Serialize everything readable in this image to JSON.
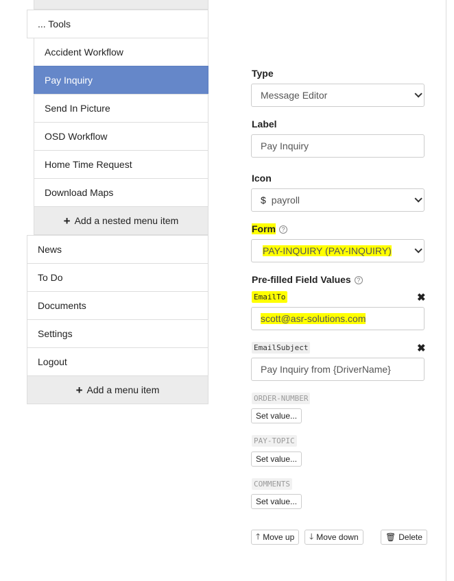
{
  "menu": {
    "tools_label": "... Tools",
    "nested_items": [
      {
        "label": "Accident Workflow"
      },
      {
        "label": "Pay Inquiry"
      },
      {
        "label": "Send In Picture"
      },
      {
        "label": "OSD Workflow"
      },
      {
        "label": "Home Time Request"
      },
      {
        "label": "Download Maps"
      }
    ],
    "add_nested_label": "Add a nested menu item",
    "items": [
      {
        "label": "News"
      },
      {
        "label": "To Do"
      },
      {
        "label": "Documents"
      },
      {
        "label": "Settings"
      },
      {
        "label": "Logout"
      }
    ],
    "add_label": "Add a menu item",
    "active_item": "Pay Inquiry",
    "active_color": "#6587c9"
  },
  "form": {
    "type_label": "Type",
    "type_value": "Message Editor",
    "label_label": "Label",
    "label_value": "Pay Inquiry",
    "icon_label": "Icon",
    "icon_value": "payroll",
    "icon_symbol": "$",
    "form_label": "Form",
    "form_value": "PAY-INQUIRY (PAY-INQUIRY)",
    "prefilled_label": "Pre-filled Field Values",
    "fields": [
      {
        "name": "EmailTo",
        "value": "scott@asr-solutions.com"
      },
      {
        "name": "EmailSubject",
        "value": "Pay Inquiry from {DriverName}"
      }
    ],
    "unset_fields": [
      {
        "name": "ORDER-NUMBER",
        "button": "Set value..."
      },
      {
        "name": "PAY-TOPIC",
        "button": "Set value..."
      },
      {
        "name": "COMMENTS",
        "button": "Set value..."
      }
    ],
    "move_up_label": "Move up",
    "move_down_label": "Move down",
    "delete_label": "Delete",
    "highlight_color": "#ffff00"
  }
}
